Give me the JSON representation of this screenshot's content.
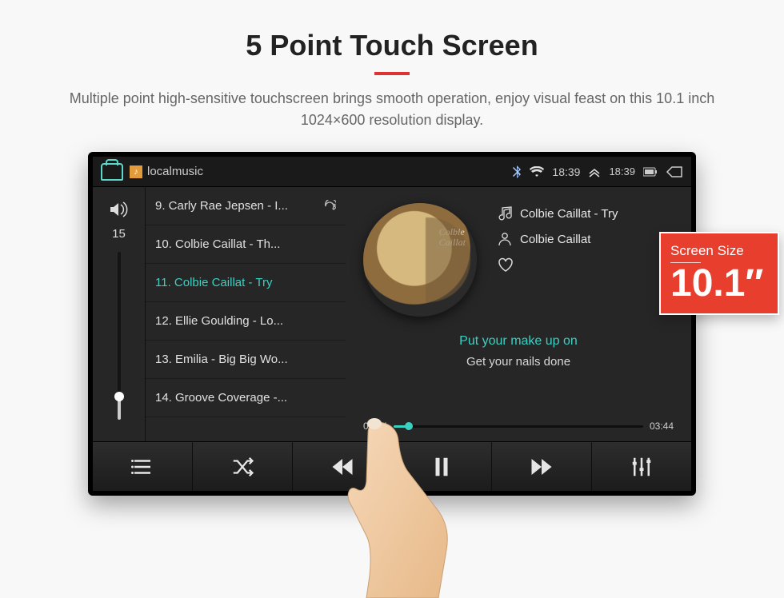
{
  "hero": {
    "title": "5 Point Touch Screen",
    "subtitle": "Multiple point high-sensitive touchscreen brings smooth operation, enjoy visual feast on this 10.1 inch 1024×600 resolution display."
  },
  "status": {
    "app_title": "localmusic",
    "time1": "18:39",
    "time2": "18:39"
  },
  "volume": {
    "value": "15"
  },
  "playlist": {
    "items": [
      "9. Carly Rae Jepsen - I...",
      "10. Colbie Caillat - Th...",
      "11. Colbie Caillat - Try",
      "12. Ellie Goulding - Lo...",
      "13. Emilia - Big Big Wo...",
      "14. Groove Coverage -..."
    ],
    "selected_index": 2
  },
  "now": {
    "album_text_1": "Colbie",
    "album_text_2": "Caillat",
    "track": "Colbie Caillat - Try",
    "artist": "Colbie Caillat",
    "lyric_current": "Put your make up on",
    "lyric_next": "Get your nails done",
    "elapsed": "00:14",
    "total": "03:44"
  },
  "badge": {
    "label": "Screen Size",
    "value": "10.1″"
  }
}
